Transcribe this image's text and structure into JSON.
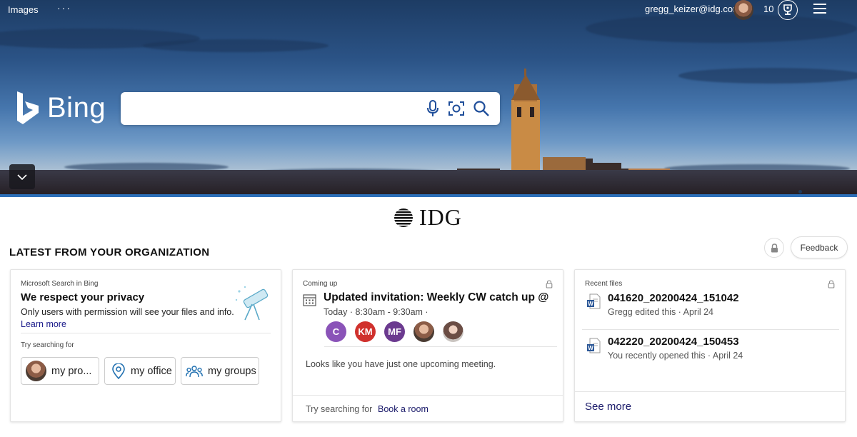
{
  "header": {
    "images_label": "Images",
    "more_label": "···",
    "email": "gregg_keizer@idg.com",
    "rewards_count": "10"
  },
  "hero": {
    "brand": "Bing",
    "search_value": ""
  },
  "org_logo": "IDG",
  "section": {
    "title": "LATEST FROM YOUR ORGANIZATION",
    "feedback_label": "Feedback"
  },
  "privacy_card": {
    "label": "Microsoft Search in Bing",
    "title": "We respect your privacy",
    "subtitle": "Only users with permission will see your files and info.",
    "learn_more": "Learn more",
    "try_label": "Try searching for",
    "pills": [
      {
        "label": "my pro...",
        "icon": "person-avatar"
      },
      {
        "label": "my office",
        "icon": "location-pin-icon"
      },
      {
        "label": "my groups",
        "icon": "people-icon"
      }
    ]
  },
  "meeting_card": {
    "label": "Coming up",
    "title": "Updated invitation: Weekly CW catch up @ ...",
    "time": "Today · 8:30am - 9:30am ·",
    "attendees": [
      {
        "initials": "C",
        "color": "#8a53b8"
      },
      {
        "initials": "KM",
        "color": "#d0312d"
      },
      {
        "initials": "MF",
        "color": "#6b3a8f"
      },
      {
        "initials": "",
        "color": "#8c5c46"
      },
      {
        "initials": "",
        "color": "#6b4d44"
      }
    ],
    "message": "Looks like you have just one upcoming meeting.",
    "try_label": "Try searching for",
    "suggestion": "Book a room"
  },
  "files_card": {
    "label": "Recent files",
    "files": [
      {
        "name": "041620_20200424_151042",
        "meta": "Gregg edited this · April 24"
      },
      {
        "name": "042220_20200424_150453",
        "meta": "You recently opened this · April 24"
      }
    ],
    "see_more": "See more"
  },
  "colors": {
    "accent_blue": "#2c6fb8",
    "link": "#1a1a8a"
  }
}
